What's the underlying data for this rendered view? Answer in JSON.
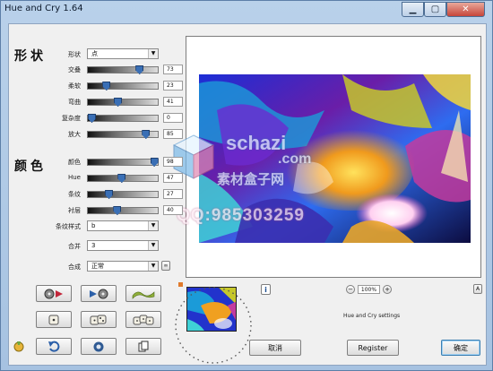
{
  "window": {
    "title": "Hue and Cry 1.64"
  },
  "shape_section": {
    "title": "形状",
    "shape_label": "形状",
    "shape_value": "点",
    "sliders": [
      {
        "label": "交叠",
        "value": "73",
        "level": 0.75
      },
      {
        "label": "柔软",
        "value": "23",
        "level": 0.23
      },
      {
        "label": "弯曲",
        "value": "41",
        "level": 0.41
      },
      {
        "label": "复杂度",
        "value": "0",
        "level": 0.0
      },
      {
        "label": "放大",
        "value": "85",
        "level": 0.85
      }
    ]
  },
  "color_section": {
    "title": "颜色",
    "sliders": [
      {
        "label": "颜色",
        "value": "98",
        "level": 0.98
      },
      {
        "label": "Hue",
        "value": "47",
        "level": 0.47
      },
      {
        "label": "条纹",
        "value": "27",
        "level": 0.27
      },
      {
        "label": "衬层",
        "value": "40",
        "level": 0.4
      }
    ],
    "stripe_label": "条纹样式",
    "stripe_value": "b",
    "merge_label": "合并",
    "merge_value": "3",
    "blend_label": "合成",
    "blend_value": "正常"
  },
  "preview": {
    "zoom_minus": "−",
    "zoom_value": "100%",
    "zoom_plus": "+",
    "settings_label": "Hue and Cry settings",
    "info_icon": "info-icon"
  },
  "buttons": {
    "cancel": "取消",
    "register": "Register",
    "ok": "确定"
  },
  "watermark": {
    "site": "schazi",
    "com": ".com",
    "brand": "素材盒子网",
    "qq": "QQ:985303259"
  },
  "colors": {
    "accent": "#3a6fb5",
    "window_frame": "#a6c2e1",
    "panel": "#f0f0f0"
  }
}
